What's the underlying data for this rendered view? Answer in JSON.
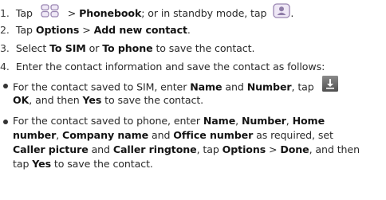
{
  "steps": [
    {
      "num": "1.",
      "a": "Tap",
      "b": ">",
      "c": "Phonebook",
      "d": "; or in standby mode, tap",
      "e": "."
    },
    {
      "num": "2.",
      "a": "Tap",
      "b": "Options",
      "c": ">",
      "d": "Add new contact",
      "e": "."
    },
    {
      "num": "3.",
      "a": "Select",
      "b": "To SIM",
      "c": "or",
      "d": "To phone",
      "e": "to save the contact."
    },
    {
      "num": "4.",
      "text": "Enter the contact information and save the contact as follows:"
    }
  ],
  "bullets": {
    "sim": {
      "l1a": "For the contact saved to SIM, enter",
      "l1b": "Name",
      "l1c": "and",
      "l1d": "Number",
      "l1e": ", tap",
      "l2a": "OK",
      "l2b": ", and then",
      "l2c": "Yes",
      "l2d": "to save the contact."
    },
    "phone": {
      "l1a": "For the contact saved to phone, enter",
      "l1b": "Name",
      "l1c": ",",
      "l1d": "Number",
      "l1e": ",",
      "l1f": "Home",
      "l2a": "number",
      "l2b": ",",
      "l2c": "Company name",
      "l2d": "and",
      "l2e": "Office number",
      "l2f": "as required, set",
      "l3a": "Caller picture",
      "l3b": "and",
      "l3c": "Caller ringtone",
      "l3d": ", tap",
      "l3e": "Options",
      "l3f": ">",
      "l3g": "Done",
      "l3h": ", and then",
      "l4a": "tap",
      "l4b": "Yes",
      "l4c": "to save the contact."
    }
  },
  "icons": {
    "menu": "grid-menu-icon",
    "contact": "contact-card-icon",
    "save": "download-arrow-icon"
  },
  "colors": {
    "icon_border": "#9a8ab0",
    "icon_fill": "#ece6f3",
    "save_icon_bg": "#6e6e6e"
  }
}
